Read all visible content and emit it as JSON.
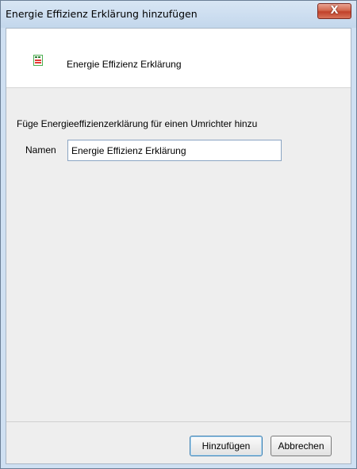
{
  "window": {
    "title": "Energie Effizienz Erklärung hinzufügen",
    "close_glyph": "X"
  },
  "header": {
    "icon": "energy-label-icon",
    "title": "Energie Effizienz Erklärung"
  },
  "form": {
    "description": "Füge Energieeffizienzerklärung für einen Umrichter hinzu",
    "name_label": "Namen",
    "name_value": "Energie Effizienz Erklärung"
  },
  "buttons": {
    "add_label": "Hinzufügen",
    "cancel_label": "Abbrechen"
  },
  "colors": {
    "close_button": "#c94a31",
    "focus_border": "#3c7fb1",
    "panel_bg": "#eeeeee"
  }
}
